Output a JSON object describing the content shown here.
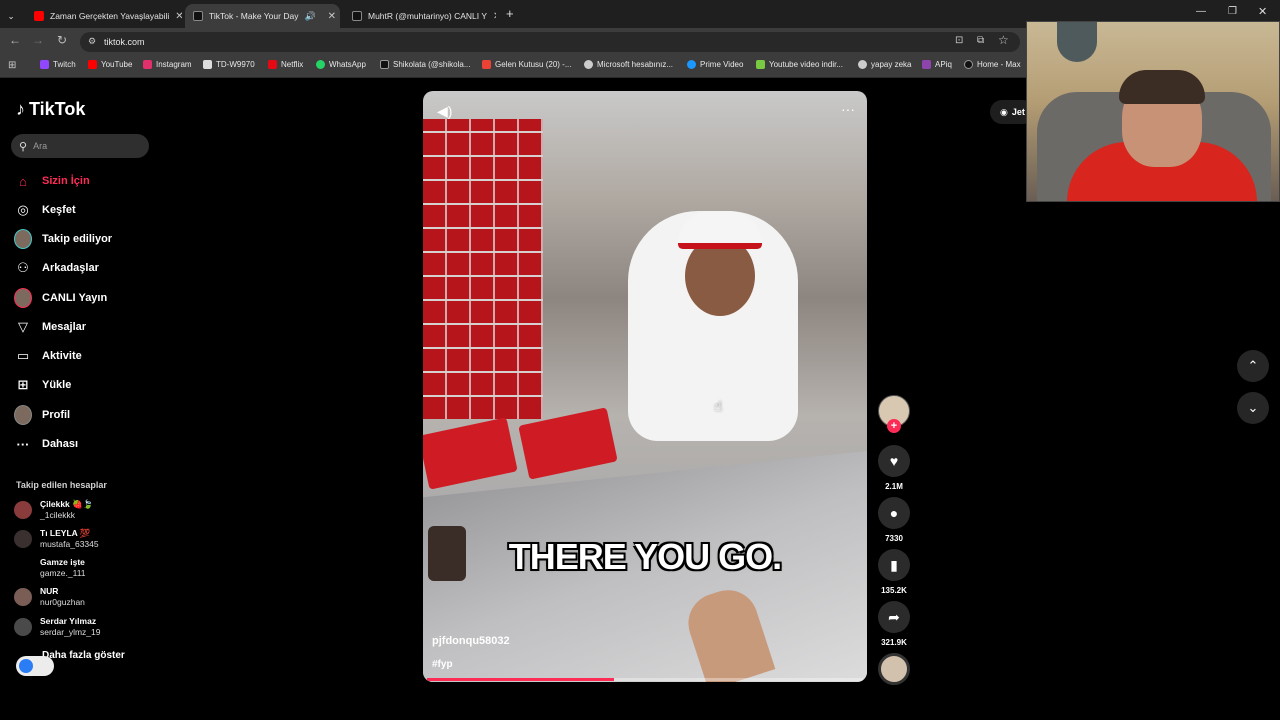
{
  "browser": {
    "tabs": [
      {
        "title": "Zaman Gerçekten Yavaşlayabili",
        "favicon_color": "#ff0000",
        "active": false
      },
      {
        "title": "TikTok - Make Your Day",
        "favicon_color": "#111111",
        "active": true
      },
      {
        "title": "MuhtR (@muhtarinyo) CANLI Y",
        "favicon_color": "#111111",
        "active": false
      }
    ],
    "new_tab": "+",
    "url": "tiktok.com",
    "bookmarks": [
      {
        "label": "Twitch",
        "color": "#9146ff"
      },
      {
        "label": "YouTube",
        "color": "#ff0000"
      },
      {
        "label": "Instagram",
        "color": "#e1306c"
      },
      {
        "label": "TD-W9970",
        "color": "#dddddd"
      },
      {
        "label": "Netflix",
        "color": "#e50914"
      },
      {
        "label": "WhatsApp",
        "color": "#25d366"
      },
      {
        "label": "Shikolata (@shikola...",
        "color": "#111111"
      },
      {
        "label": "Gelen Kutusu (20) -...",
        "color": "#ea4335"
      },
      {
        "label": "Microsoft hesabınız...",
        "color": "#cccccc"
      },
      {
        "label": "Prime Video",
        "color": "#1a98ff"
      },
      {
        "label": "Youtube video indir...",
        "color": "#7ac943"
      },
      {
        "label": "yapay zeka",
        "color": "#cccccc"
      },
      {
        "label": "APiq",
        "color": "#8e44ad"
      },
      {
        "label": "Home - Max",
        "color": "#111111"
      }
    ]
  },
  "tiktok": {
    "logo": "TikTok",
    "search_placeholder": "Ara",
    "nav": [
      {
        "label": "Sizin İçin",
        "icon": "home-icon",
        "glyph": "⌂"
      },
      {
        "label": "Keşfet",
        "icon": "compass-icon",
        "glyph": "◎"
      },
      {
        "label": "Takip ediliyor",
        "icon": "following-avatar-icon",
        "glyph": ""
      },
      {
        "label": "Arkadaşlar",
        "icon": "friends-icon",
        "glyph": "⚇"
      },
      {
        "label": "CANLI Yayın",
        "icon": "live-avatar-icon",
        "glyph": ""
      },
      {
        "label": "Mesajlar",
        "icon": "send-icon",
        "glyph": "➤"
      },
      {
        "label": "Aktivite",
        "icon": "activity-icon",
        "glyph": "▭"
      },
      {
        "label": "Yükle",
        "icon": "upload-icon",
        "glyph": "⊞"
      },
      {
        "label": "Profil",
        "icon": "profile-avatar-icon",
        "glyph": ""
      },
      {
        "label": "Dahası",
        "icon": "more-dots-icon",
        "glyph": "···"
      }
    ],
    "following_title": "Takip edilen hesaplar",
    "following": [
      {
        "name": "Çilekkk 🍓🍃",
        "handle": "_1cilekkk"
      },
      {
        "name": "Tı LEYLA 💯",
        "handle": "mustafa_63345"
      },
      {
        "name": "Gamze işte",
        "handle": "gamze._111"
      },
      {
        "name": "NUR",
        "handle": "nur0guzhan"
      },
      {
        "name": "Serdar Yılmaz",
        "handle": "serdar_ylmz_19"
      }
    ],
    "show_more": "Daha fazla göster",
    "get_app": "Jet",
    "video": {
      "caption": "THERE YOU GO.",
      "username": "pjfdonqu58032",
      "hashtag": "#fyp",
      "progress": 0.43
    },
    "actions": {
      "likes": "2.1M",
      "comments": "7330",
      "saves": "135.2K",
      "shares": "321.9K"
    }
  }
}
